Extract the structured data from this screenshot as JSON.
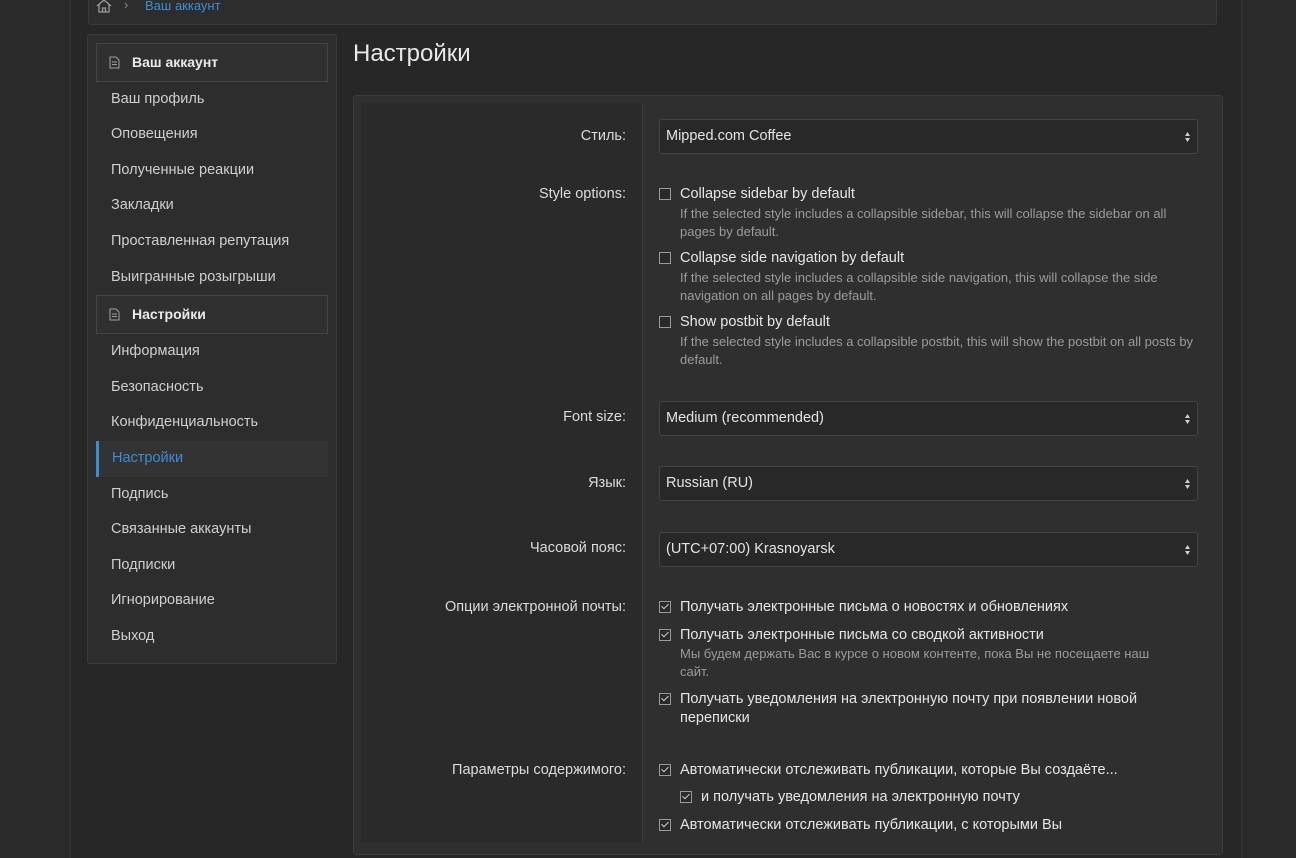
{
  "breadcrumb": {
    "current": "Ваш аккаунт",
    "separator": "›"
  },
  "sidebar": {
    "account_header": "Ваш аккаунт",
    "account_items": [
      "Ваш профиль",
      "Оповещения",
      "Полученные реакции",
      "Закладки",
      "Проставленная репутация",
      "Выигранные розыгрыши"
    ],
    "settings_header": "Настройки",
    "settings_items": [
      "Информация",
      "Безопасность",
      "Конфиденциальность",
      "Настройки",
      "Подпись",
      "Связанные аккаунты",
      "Подписки",
      "Игнорирование",
      "Выход"
    ],
    "active_item": "Настройки"
  },
  "page": {
    "title": "Настройки"
  },
  "form": {
    "style_label": "Стиль:",
    "style_value": "Mipped.com Coffee",
    "style_options_label": "Style options:",
    "style_options": [
      {
        "label": "Collapse sidebar by default",
        "hint": "If the selected style includes a collapsible sidebar, this will collapse the sidebar on all pages by default.",
        "checked": false
      },
      {
        "label": "Collapse side navigation by default",
        "hint": "If the selected style includes a collapsible side navigation, this will collapse the side navigation on all pages by default.",
        "checked": false
      },
      {
        "label": "Show postbit by default",
        "hint": "If the selected style includes a collapsible postbit, this will show the postbit on all posts by default.",
        "checked": false
      }
    ],
    "font_size_label": "Font size:",
    "font_size_value": "Medium (recommended)",
    "language_label": "Язык:",
    "language_value": "Russian (RU)",
    "timezone_label": "Часовой пояс:",
    "timezone_value": "(UTC+07:00) Krasnoyarsk",
    "email_label": "Опции электронной почты:",
    "email_options": [
      {
        "label": "Получать электронные письма о новостях и обновлениях",
        "checked": true
      },
      {
        "label": "Получать электронные письма со сводкой активности",
        "hint": "Мы будем держать Вас в курсе о новом контенте, пока Вы не посещаете наш сайт.",
        "checked": true
      },
      {
        "label": "Получать уведомления на электронную почту при появлении новой переписки",
        "checked": true
      }
    ],
    "content_label": "Параметры содержимого:",
    "content_options": [
      {
        "label": "Автоматически отслеживать публикации, которые Вы создаёте...",
        "checked": true
      },
      {
        "label": "и получать уведомления на электронную почту",
        "checked": true
      },
      {
        "label": "Автоматически отслеживать публикации, с которыми Вы",
        "checked": true
      }
    ]
  },
  "colors": {
    "accent": "#3a8ed6",
    "background": "#272727",
    "panel": "#2f2f2f"
  }
}
